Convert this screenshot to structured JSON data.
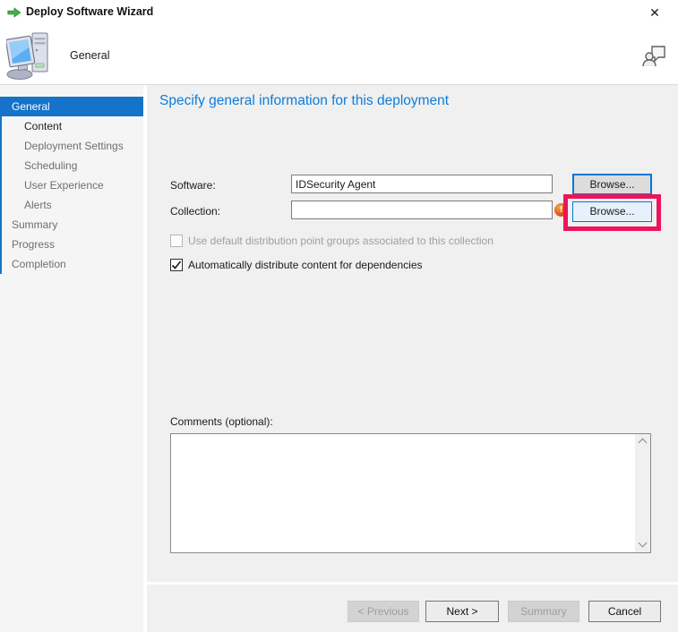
{
  "window": {
    "title": "Deploy Software Wizard",
    "close_glyph": "✕"
  },
  "header": {
    "page_title": "General",
    "icons": [
      "green-arrow-icon",
      "computer-icon",
      "feedback-person-icon",
      "close-icon"
    ]
  },
  "sidebar": {
    "items": [
      {
        "label": "General",
        "state": "selected",
        "indent": 1
      },
      {
        "label": "Content",
        "state": "enabled",
        "indent": 2
      },
      {
        "label": "Deployment Settings",
        "state": "dimmed",
        "indent": 2
      },
      {
        "label": "Scheduling",
        "state": "dimmed",
        "indent": 2
      },
      {
        "label": "User Experience",
        "state": "dimmed",
        "indent": 2
      },
      {
        "label": "Alerts",
        "state": "dimmed",
        "indent": 2
      },
      {
        "label": "Summary",
        "state": "dimmed",
        "indent": 1
      },
      {
        "label": "Progress",
        "state": "dimmed",
        "indent": 1
      },
      {
        "label": "Completion",
        "state": "dimmed",
        "indent": 1
      }
    ]
  },
  "main": {
    "heading": "Specify general information for this deployment",
    "fields": {
      "software_label": "Software:",
      "software_value": "IDSecurity Agent",
      "collection_label": "Collection:",
      "collection_value": "",
      "browse_label_1": "Browse...",
      "browse_label_2": "Browse...",
      "error_glyph": "!"
    },
    "checkboxes": [
      {
        "label": "Use default distribution point groups associated to this collection",
        "checked": false,
        "disabled": true
      },
      {
        "label": "Automatically distribute content for dependencies",
        "checked": true,
        "disabled": false
      }
    ],
    "comments_label": "Comments (optional):",
    "comments_value": ""
  },
  "footer": {
    "previous_label": "< Previous",
    "next_label": "Next >",
    "summary_label": "Summary",
    "cancel_label": "Cancel"
  },
  "colors": {
    "selection_blue": "#1573c9",
    "heading_blue": "#0d7cd9",
    "button_focus_blue": "#0078d7",
    "highlight_pink": "#ec155b",
    "error_orange": "#dd4f1d",
    "panel_gray": "#f0f0f0"
  }
}
